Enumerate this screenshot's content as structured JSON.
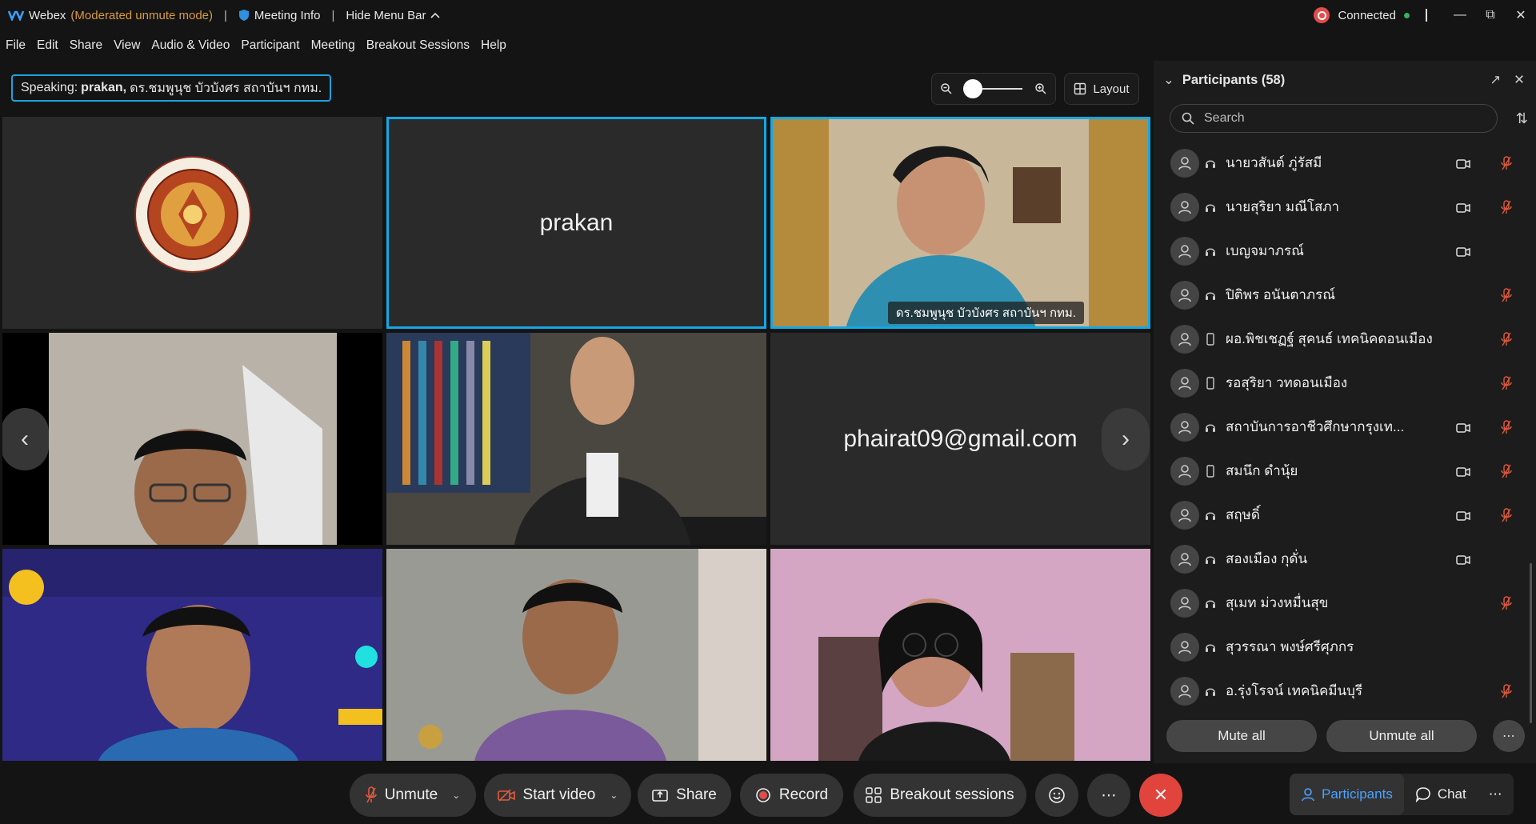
{
  "titlebar": {
    "app": "Webex",
    "mode": "(Moderated unmute mode)",
    "meeting_info": "Meeting Info",
    "hide_menu": "Hide Menu Bar",
    "status": "Connected"
  },
  "menu": [
    "File",
    "Edit",
    "Share",
    "View",
    "Audio & Video",
    "Participant",
    "Meeting",
    "Breakout Sessions",
    "Help"
  ],
  "speaking": {
    "prefix": "Speaking:",
    "name": "prakan,",
    "rest": "ดร.ชมพูนุช บัวบังศร สถาบันฯ กทม."
  },
  "view": {
    "layout_label": "Layout"
  },
  "tiles": {
    "prakan": "prakan",
    "speaker_label": "ดร.ชมพูนุช บัวบังศร สถาบันฯ กทม.",
    "email": "phairat09@gmail.com"
  },
  "controls": {
    "unmute": "Unmute",
    "start_video": "Start video",
    "share": "Share",
    "record": "Record",
    "breakout": "Breakout sessions",
    "participants": "Participants",
    "chat": "Chat"
  },
  "panel": {
    "title": "Participants (58)",
    "search_placeholder": "Search",
    "mute_all": "Mute all",
    "unmute_all": "Unmute all",
    "participants": [
      {
        "name": "นายวสันต์ ภู่รัสมี",
        "device": "headset",
        "video": true,
        "muted": true
      },
      {
        "name": "นายสุริยา มณีโสภา",
        "device": "headset",
        "video": true,
        "muted": true
      },
      {
        "name": "เบญจมาภรณ์",
        "device": "headset",
        "video": true,
        "muted": false
      },
      {
        "name": "ปิติพร อนันตาภรณ์",
        "device": "headset",
        "video": false,
        "muted": true
      },
      {
        "name": "ผอ.พิชเชฏฐ์ สุคนธ์ เทคนิคดอนเมือง",
        "device": "phone",
        "video": false,
        "muted": true
      },
      {
        "name": "รอสุริยา วทดอนเมือง",
        "device": "phone",
        "video": false,
        "muted": true
      },
      {
        "name": "สถาบันการอาชีวศึกษากรุงเท...",
        "device": "headset",
        "video": true,
        "muted": true
      },
      {
        "name": "สมนึก ดำนุ้ย",
        "device": "phone",
        "video": true,
        "muted": true
      },
      {
        "name": "สฤษดิ์",
        "device": "headset",
        "video": true,
        "muted": true
      },
      {
        "name": "สองเมือง กุดั่น",
        "device": "headset",
        "video": true,
        "muted": false
      },
      {
        "name": "สุเมท ม่วงหมื่นสุข",
        "device": "headset",
        "video": false,
        "muted": true
      },
      {
        "name": "สุวรรณา พงษ์ศรีศุภกร",
        "device": "headset",
        "video": false,
        "muted": false
      },
      {
        "name": "อ.รุ่งโรจน์ เทคนิคมีนบุรี",
        "device": "headset",
        "video": false,
        "muted": true
      }
    ]
  },
  "colors": {
    "accent": "#12a9e6",
    "end_call": "#e0443d",
    "muted": "#e25a3c",
    "mode_text": "#d99a3d"
  }
}
